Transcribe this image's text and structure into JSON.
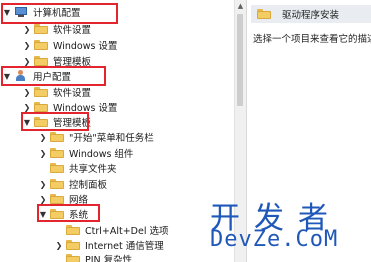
{
  "tree": {
    "items": [
      {
        "label": "计算机配置",
        "icon": "computer-icon",
        "chevron": "expanded"
      },
      {
        "label": "软件设置",
        "icon": "folder-icon",
        "chevron": "collapsed"
      },
      {
        "label": "Windows 设置",
        "icon": "folder-icon",
        "chevron": "collapsed"
      },
      {
        "label": "管理模板",
        "icon": "folder-icon",
        "chevron": "collapsed"
      },
      {
        "label": "用户配置",
        "icon": "user-icon",
        "chevron": "expanded"
      },
      {
        "label": "软件设置",
        "icon": "folder-icon",
        "chevron": "collapsed"
      },
      {
        "label": "Windows 设置",
        "icon": "folder-icon",
        "chevron": "collapsed"
      },
      {
        "label": "管理模板",
        "icon": "folder-icon",
        "chevron": "expanded"
      },
      {
        "label": "\"开始\"菜单和任务栏",
        "icon": "folder-icon",
        "chevron": "collapsed"
      },
      {
        "label": "Windows 组件",
        "icon": "folder-icon",
        "chevron": "collapsed"
      },
      {
        "label": "共享文件夹",
        "icon": "folder-icon",
        "chevron": "none"
      },
      {
        "label": "控制面板",
        "icon": "folder-icon",
        "chevron": "collapsed"
      },
      {
        "label": "网络",
        "icon": "folder-icon",
        "chevron": "collapsed"
      },
      {
        "label": "系统",
        "icon": "folder-icon",
        "chevron": "expanded"
      },
      {
        "label": "Ctrl+Alt+Del 选项",
        "icon": "folder-icon",
        "chevron": "none"
      },
      {
        "label": "Internet 通信管理",
        "icon": "folder-icon",
        "chevron": "collapsed"
      },
      {
        "label": "PIN 复杂性",
        "icon": "folder-icon",
        "chevron": "none"
      }
    ]
  },
  "details": {
    "header": "驱动程序安装",
    "description": "选择一个项目来查看它的描述"
  },
  "watermark": {
    "cn": "开发者",
    "en": "DevZe.CoM"
  },
  "colors": {
    "highlight_box": "#e3262e",
    "folder": "#f3cd63",
    "watermark": "#1f58b8"
  }
}
